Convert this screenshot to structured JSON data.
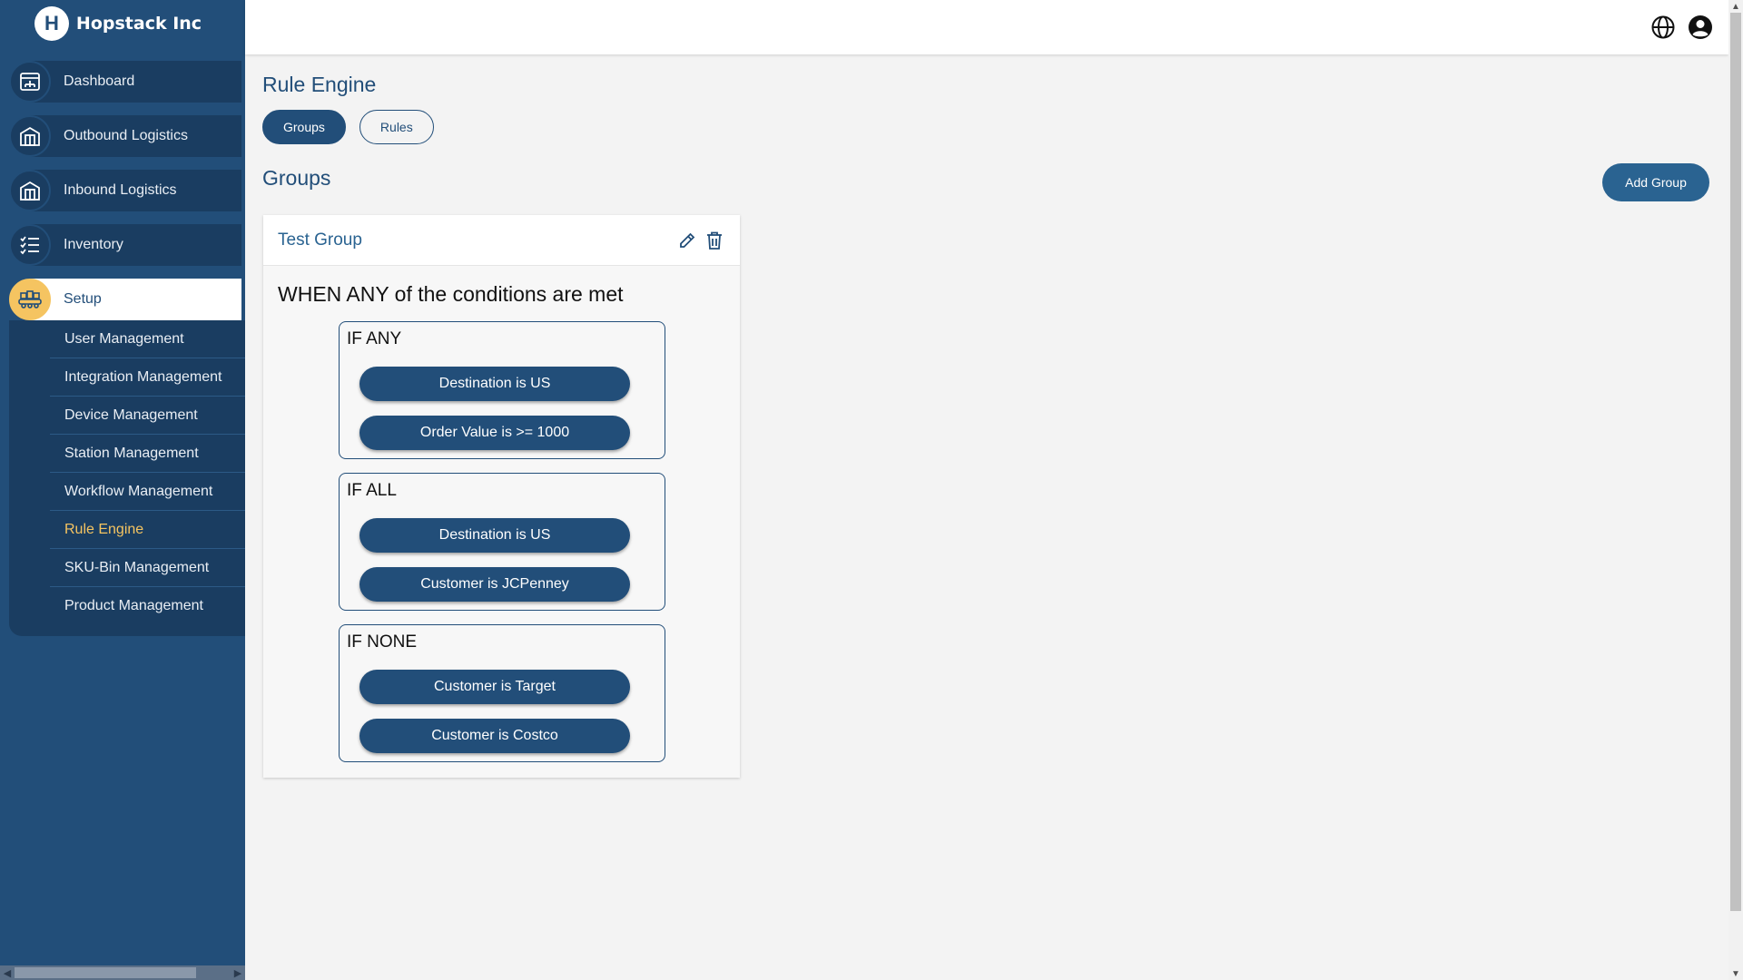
{
  "brand": {
    "name": "Hopstack Inc",
    "logo_letter": "H"
  },
  "sidebar": {
    "items": [
      {
        "label": "Dashboard",
        "icon": "dashboard-icon"
      },
      {
        "label": "Outbound Logistics",
        "icon": "warehouse-icon"
      },
      {
        "label": "Inbound Logistics",
        "icon": "warehouse-icon"
      },
      {
        "label": "Inventory",
        "icon": "list-icon"
      },
      {
        "label": "Setup",
        "icon": "setup-icon",
        "active": true
      }
    ],
    "sub_items": [
      {
        "label": "User Management"
      },
      {
        "label": "Integration Management"
      },
      {
        "label": "Device Management"
      },
      {
        "label": "Station Management"
      },
      {
        "label": "Workflow Management"
      },
      {
        "label": "Rule Engine",
        "active": true
      },
      {
        "label": "SKU-Bin Management"
      },
      {
        "label": "Product Management"
      }
    ]
  },
  "topbar": {
    "icons": [
      "globe-icon",
      "user-account-icon"
    ]
  },
  "main": {
    "title": "Rule Engine",
    "tabs": [
      {
        "label": "Groups",
        "active": true
      },
      {
        "label": "Rules",
        "active": false
      }
    ],
    "section_title": "Groups",
    "add_group_label": "Add Group",
    "group": {
      "name": "Test Group",
      "when_text": "WHEN ANY of the conditions are met",
      "conditions": [
        {
          "label": "IF ANY",
          "rules": [
            "Destination is US",
            "Order Value is >= 1000"
          ]
        },
        {
          "label": "IF ALL",
          "rules": [
            "Destination is US",
            "Customer is JCPenney"
          ]
        },
        {
          "label": "IF NONE",
          "rules": [
            "Customer is Target",
            "Customer is Costco"
          ]
        }
      ]
    }
  },
  "colors": {
    "primary": "#224e79",
    "sidebar_dark": "#1a3d61",
    "accent": "#f5c461",
    "background": "#f3f3f3"
  }
}
